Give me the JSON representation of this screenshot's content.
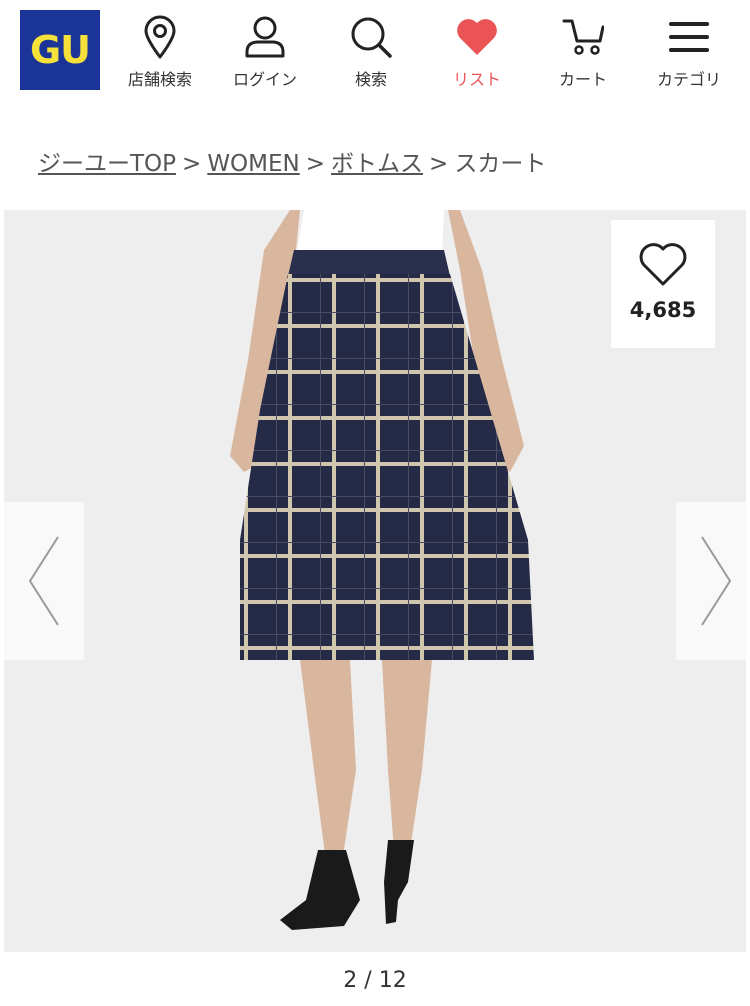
{
  "header": {
    "logo_text": "GU",
    "logo_bg": "#1a3597",
    "logo_fg": "#f6e03a",
    "nav": [
      {
        "label": "店舗検索",
        "icon": "location-pin-icon"
      },
      {
        "label": "ログイン",
        "icon": "user-icon"
      },
      {
        "label": "検索",
        "icon": "search-icon"
      },
      {
        "label": "リスト",
        "icon": "heart-icon",
        "color": "#ea5457"
      },
      {
        "label": "カート",
        "icon": "cart-icon"
      },
      {
        "label": "カテゴリ",
        "icon": "menu-icon"
      }
    ]
  },
  "breadcrumb": {
    "items": [
      "ジーユーTOP",
      "WOMEN",
      "ボトムス"
    ],
    "current": "スカート",
    "separator": ">"
  },
  "product": {
    "favorite_count": "4,685",
    "image_subject": "navy windowpane check flared midi skirt worn with black pumps"
  },
  "gallery": {
    "counter": "2 / 12",
    "current": 2,
    "total": 12
  }
}
